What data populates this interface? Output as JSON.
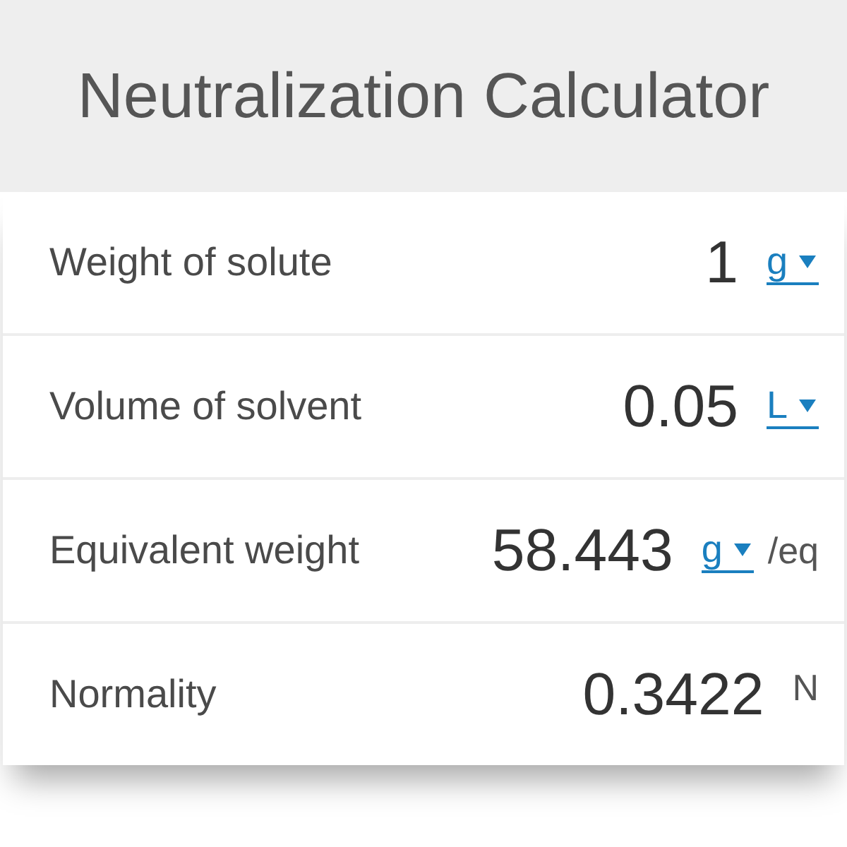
{
  "title": "Neutralization Calculator",
  "rows": [
    {
      "label": "Weight of solute",
      "value": "1",
      "unit": {
        "kind": "select",
        "text": "g"
      }
    },
    {
      "label": "Volume of solvent",
      "value": "0.05",
      "unit": {
        "kind": "select",
        "text": "L"
      }
    },
    {
      "label": "Equivalent weight",
      "value": "58.443",
      "unit": {
        "kind": "select",
        "text": "g"
      },
      "suffix": "/eq"
    },
    {
      "label": "Normality",
      "value": "0.3422",
      "unit": {
        "kind": "text",
        "text": "N"
      }
    }
  ]
}
